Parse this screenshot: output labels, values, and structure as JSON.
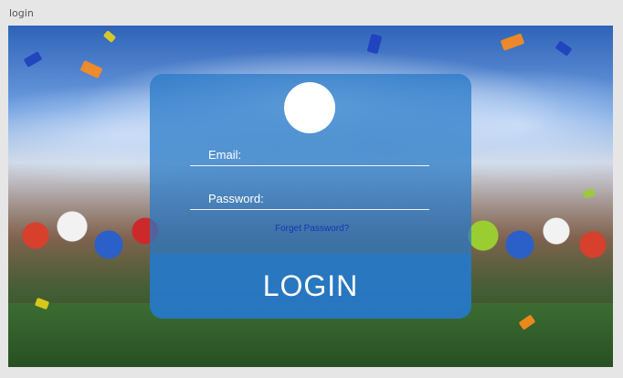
{
  "artboard": {
    "label": "login"
  },
  "login_form": {
    "avatar_icon": "user-avatar-circle",
    "email": {
      "label": "Email:",
      "value": ""
    },
    "password": {
      "label": "Password:",
      "value": ""
    },
    "forgot_password_label": "Forget Password?",
    "login_button_label": "LOGIN"
  },
  "colors": {
    "card_overlay": "#2678c8",
    "link": "#1a33b8",
    "text": "#ffffff",
    "canvas": "#e6e6e6"
  }
}
